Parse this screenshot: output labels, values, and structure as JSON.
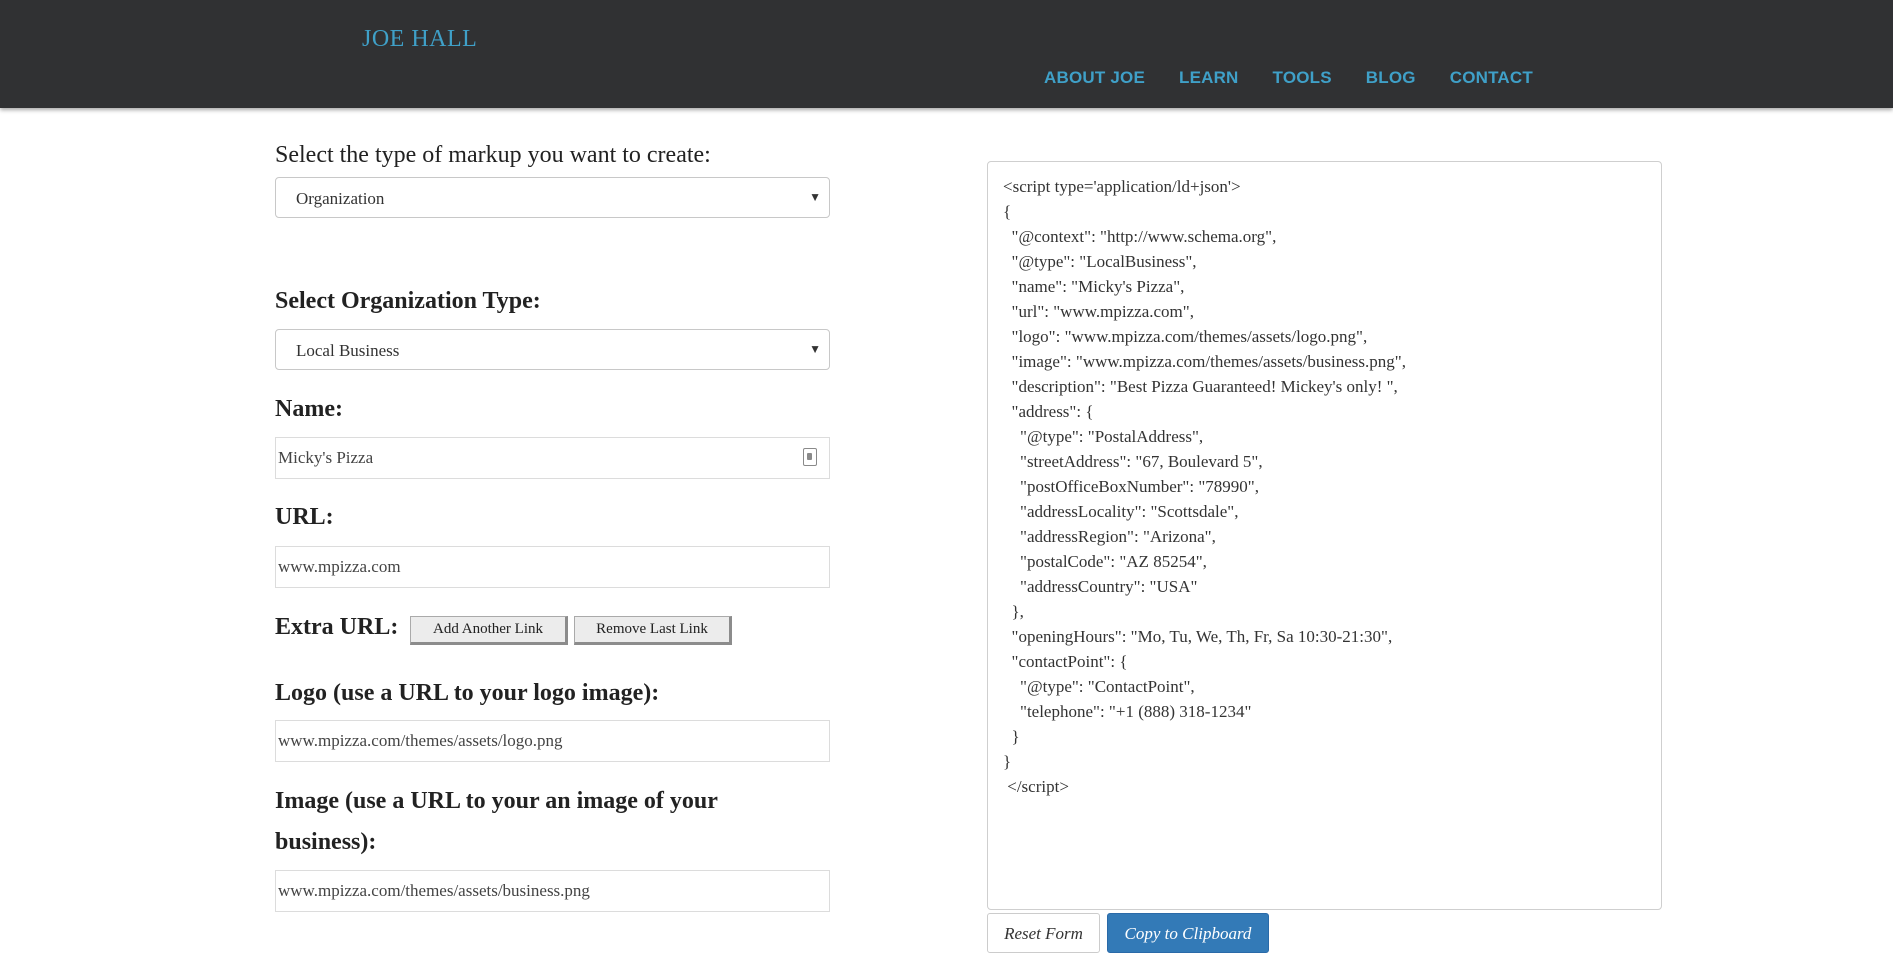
{
  "header": {
    "brand": "JOE HALL",
    "nav": [
      "ABOUT JOE",
      "LEARN",
      "TOOLS",
      "BLOG",
      "CONTACT"
    ]
  },
  "form": {
    "markup_label": "Select the type of markup you want to create:",
    "markup_value": "Organization",
    "org_type_label": "Select Organization Type:",
    "org_type_value": "Local Business",
    "name_label": "Name:",
    "name_value": "Micky's Pizza",
    "url_label": "URL:",
    "url_value": "www.mpizza.com",
    "extra_url_label": "Extra URL:",
    "add_link_label": "Add Another Link",
    "remove_link_label": "Remove Last Link",
    "logo_label": "Logo (use a URL to your logo image):",
    "logo_value": "www.mpizza.com/themes/assets/logo.png",
    "image_label_line1": "Image (use a URL to your an image of your",
    "image_label_line2": "business):",
    "image_value": "www.mpizza.com/themes/assets/business.png"
  },
  "output": {
    "code": "<script type='application/ld+json'>\n{\n  \"@context\": \"http://www.schema.org\",\n  \"@type\": \"LocalBusiness\",\n  \"name\": \"Micky's Pizza\",\n  \"url\": \"www.mpizza.com\",\n  \"logo\": \"www.mpizza.com/themes/assets/logo.png\",\n  \"image\": \"www.mpizza.com/themes/assets/business.png\",\n  \"description\": \"Best Pizza Guaranteed! Mickey's only! \",\n  \"address\": {\n    \"@type\": \"PostalAddress\",\n    \"streetAddress\": \"67, Boulevard 5\",\n    \"postOfficeBoxNumber\": \"78990\",\n    \"addressLocality\": \"Scottsdale\",\n    \"addressRegion\": \"Arizona\",\n    \"postalCode\": \"AZ 85254\",\n    \"addressCountry\": \"USA\"\n  },\n  \"openingHours\": \"Mo, Tu, We, Th, Fr, Sa 10:30-21:30\",\n  \"contactPoint\": {\n    \"@type\": \"ContactPoint\",\n    \"telephone\": \"+1 (888) 318-1234\"\n  }\n}\n </script>",
    "reset_label": "Reset Form",
    "copy_label": "Copy to Clipboard"
  },
  "colors": {
    "header_bg": "#303133",
    "accent": "#3fa0c8",
    "primary_button": "#337ab7"
  }
}
